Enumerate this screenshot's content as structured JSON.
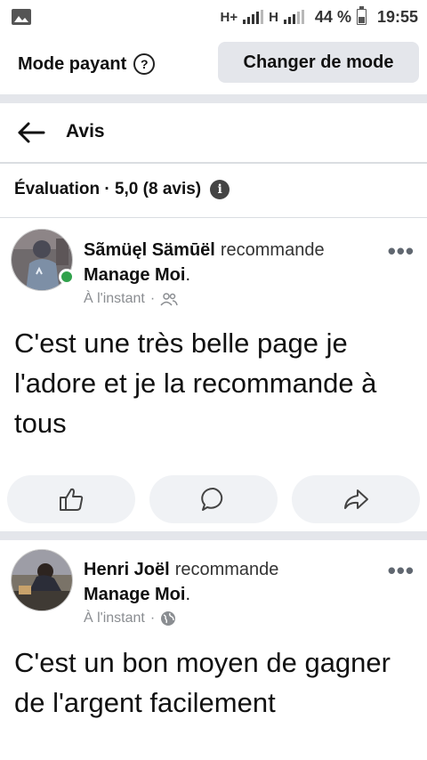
{
  "status_bar": {
    "network_1": "H+",
    "network_2": "H",
    "battery_percent": "44 %",
    "time": "19:55"
  },
  "mode_bar": {
    "label": "Mode payant",
    "help_icon": "question-circle-icon",
    "change_button": "Changer de mode"
  },
  "header": {
    "back_icon": "arrow-left-icon",
    "title": "Avis"
  },
  "rating": {
    "text": "Évaluation · 5,0 (8 avis)",
    "info_icon": "info-icon"
  },
  "reviews": [
    {
      "author": "Sãmüęl Sämūël",
      "verb": "recommande",
      "page": "Manage Moi",
      "time": "À l'instant",
      "audience_icon": "friends-icon",
      "online": true,
      "text": "C'est une très belle page je l'adore et je la recommande à tous",
      "actions": [
        "like-icon",
        "comment-icon",
        "share-icon"
      ]
    },
    {
      "author": "Henri Joël",
      "verb": "recommande",
      "page": "Manage Moi",
      "time": "À l'instant",
      "audience_icon": "globe-icon",
      "online": false,
      "text": "C'est un bon moyen de gagner de l'argent facilement"
    }
  ],
  "colors": {
    "online_green": "#31a24c",
    "separator": "#e4e6eb",
    "button_bg": "#e4e6eb",
    "pill_bg": "#f0f2f5",
    "meta_gray": "#8a8d91"
  }
}
